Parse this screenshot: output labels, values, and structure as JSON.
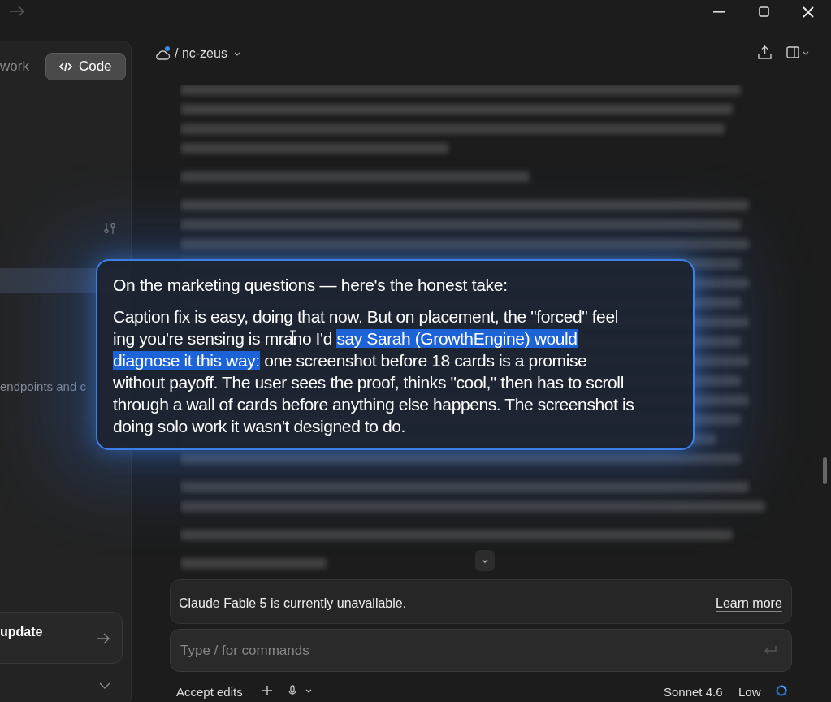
{
  "sidebar": {
    "tabs": [
      {
        "label": "work",
        "selected": false
      },
      {
        "label": "Code",
        "selected": true
      }
    ],
    "item_text": "endpoints and c",
    "update_card": {
      "label": "update"
    }
  },
  "header": {
    "project": "/ nc-zeus"
  },
  "popup": {
    "heading": "On the marketing questions — here's the honest take:",
    "lines": [
      [
        {
          "text": "Caption fix is easy, doing that now. But on placement, the \"forced\" feel",
          "selected": false
        }
      ],
      [
        {
          "text": "ing you're sensing is mrano I'd ",
          "selected": false
        },
        {
          "text": "say Sarah (GrowthEngine) would",
          "selected": true
        }
      ],
      [
        {
          "text": "diagnose it this way:",
          "selected": true
        },
        {
          "text": " one screenshot before 18 cards is a promise",
          "selected": false
        }
      ],
      [
        {
          "text": "without payoff. The user sees the proof, thinks \"cool,\" then has to scroll",
          "selected": false
        }
      ],
      [
        {
          "text": "through a wall of cards before anything else happens. The screenshot is",
          "selected": false
        }
      ],
      [
        {
          "text": "doing solo work it wasn't designed to do.",
          "selected": false
        }
      ]
    ]
  },
  "notice": {
    "text": "Claude Fable 5 is currently unavallable.",
    "link": "Learn more"
  },
  "composer": {
    "placeholder": "Type / for commands"
  },
  "footer": {
    "mode": "Accept edits",
    "model": "Sonnet 4.6",
    "effort": "Low"
  }
}
